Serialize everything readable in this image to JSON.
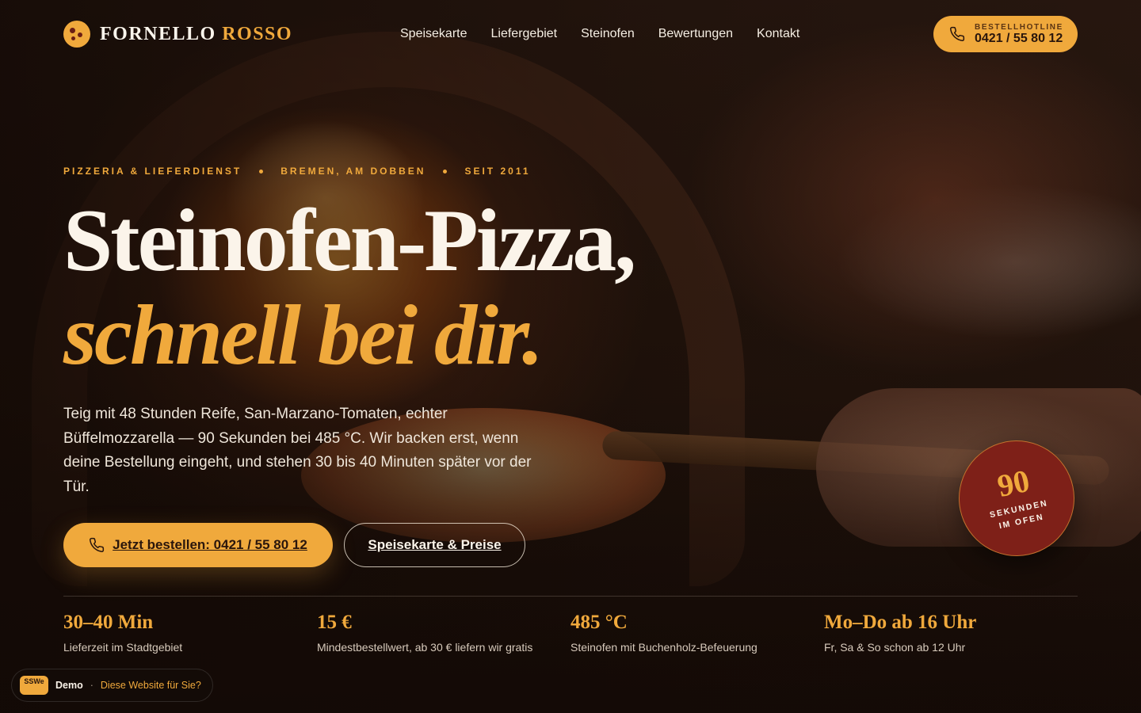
{
  "brand": {
    "name_part1": "FORNELLO",
    "name_part2": "ROSSO",
    "icon": "pizza-logo-icon"
  },
  "nav": {
    "items": [
      {
        "label": "Speisekarte"
      },
      {
        "label": "Liefergebiet"
      },
      {
        "label": "Steinofen"
      },
      {
        "label": "Bewertungen"
      },
      {
        "label": "Kontakt"
      }
    ]
  },
  "hotline": {
    "caption": "BESTELLHOTLINE",
    "number": "0421 / 55 80 12",
    "icon": "phone-icon"
  },
  "hero": {
    "eyebrow": [
      "PIZZERIA & LIEFERDIENST",
      "BREMEN, AM DOBBEN",
      "SEIT 2011"
    ],
    "title_line1": "Steinofen-Pizza,",
    "title_line2": "schnell bei dir.",
    "lead": "Teig mit 48 Stunden Reife, San-Marzano-Tomaten, echter Büffelmozzarella — 90 Sekunden bei 485 °C. Wir backen erst, wenn deine Bestellung eingeht, und stehen 30 bis 40 Minuten später vor der Tür.",
    "cta_primary": "Jetzt bestellen: 0421 / 55 80 12",
    "cta_secondary": "Speisekarte & Preise"
  },
  "badge": {
    "number": "90",
    "text_line1": "SEKUNDEN",
    "text_line2": "IM OFEN"
  },
  "stats": [
    {
      "value": "30–40 Min",
      "label": "Lieferzeit im Stadtgebiet"
    },
    {
      "value": "15 €",
      "label": "Mindestbestellwert, ab 30 € liefern wir gratis"
    },
    {
      "value": "485 °C",
      "label": "Steinofen mit Buchenholz-Befeuerung"
    },
    {
      "value": "Mo–Do ab 16 Uhr",
      "label": "Fr, Sa & So schon ab 12 Uhr"
    }
  ],
  "demo_bar": {
    "tag": "SSWe",
    "label": "Demo",
    "separator": "·",
    "link": "Diese Website für Sie?"
  },
  "colors": {
    "accent": "#f0a93c",
    "badge": "#7e2018",
    "background": "#1a0f0a"
  }
}
